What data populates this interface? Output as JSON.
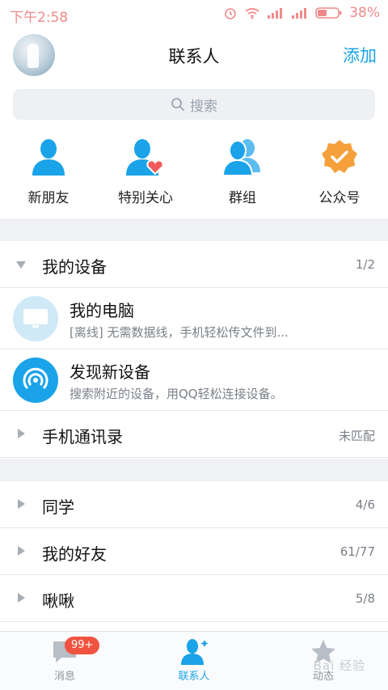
{
  "status_bar": {
    "time": "下午2:58",
    "battery": "38%",
    "icons": [
      "alarm-icon",
      "wifi-icon",
      "signal-icon",
      "signal-icon",
      "battery-icon"
    ]
  },
  "header": {
    "title": "联系人",
    "add_label": "添加"
  },
  "search": {
    "placeholder": "搜索"
  },
  "quick_actions": [
    {
      "label": "新朋友",
      "icon": "person-icon"
    },
    {
      "label": "特别关心",
      "icon": "person-heart-icon"
    },
    {
      "label": "群组",
      "icon": "group-icon"
    },
    {
      "label": "公众号",
      "icon": "check-badge-icon"
    }
  ],
  "groups": {
    "my_devices": {
      "name": "我的设备",
      "count": "1/2"
    },
    "contacts_book": {
      "name": "手机通讯录",
      "count": "未匹配"
    },
    "classmates": {
      "name": "同学",
      "count": "4/6"
    },
    "my_friends": {
      "name": "我的好友",
      "count": "61/77"
    },
    "jiujiu": {
      "name": "啾啾",
      "count": "5/8"
    }
  },
  "devices": [
    {
      "title": "我的电脑",
      "subtitle": "[离线] 无需数据线，手机轻松传文件到...",
      "icon": "monitor-icon"
    },
    {
      "title": "发现新设备",
      "subtitle": "搜索附近的设备，用QQ轻松连接设备。",
      "icon": "radar-icon"
    }
  ],
  "tabs": [
    {
      "label": "消息",
      "icon": "message-icon",
      "badge": "99+"
    },
    {
      "label": "联系人",
      "icon": "contacts-icon"
    },
    {
      "label": "动态",
      "icon": "star-icon"
    }
  ],
  "watermark": "Bai 经验",
  "colors": {
    "accent": "#1aa3e8",
    "badge": "#f0533f",
    "heart": "#f05a5a",
    "official": "#f5a03a"
  }
}
